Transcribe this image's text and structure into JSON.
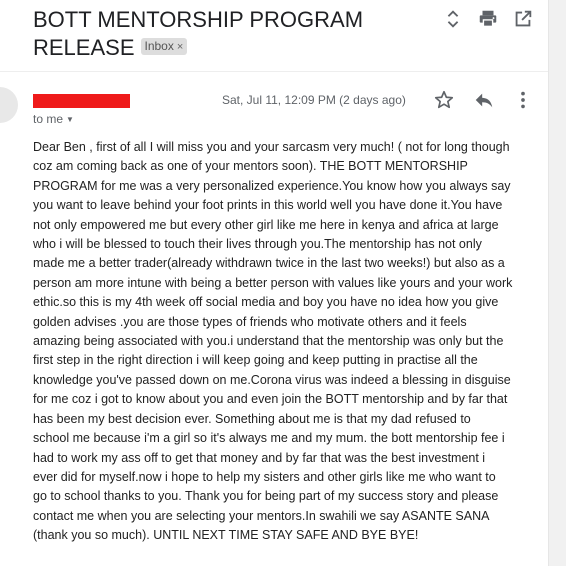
{
  "email": {
    "subject_line1": "BOTT MENTORSHIP PROGRAM",
    "subject_line2": "RELEASE",
    "label_chip": "Inbox",
    "label_remove": "×",
    "date": "Sat, Jul 11, 12:09 PM (2 days ago)",
    "to_text": "to me",
    "to_caret": "▼",
    "body_lines": [
      "Dear Ben , first of all I will miss you and your sarcasm very much! ( not for long though",
      "coz am coming back as one of your mentors soon). THE BOTT MENTORSHIP",
      "PROGRAM for me was a very personalized experience.You know how you always say",
      "you want to leave behind your foot prints in this world well you have done it.You have",
      "not only empowered me but every other girl like me here in kenya  and africa at large",
      "who i will be  blessed to touch their lives through you.The mentorship has not only",
      "made me a better trader(already withdrawn twice in the last two weeks!) but also as a",
      "person am more intune with being a better person with values like yours and your work",
      "ethic.so this is my 4th week off social media and boy you have no idea how you give",
      "golden advises .you are those types of friends who motivate others and it feels",
      "amazing being associated with you.i understand that the mentorship was only but the",
      "first step in the right direction i will keep going and keep putting in practise all the",
      "knowledge you've passed down on me.Corona virus was indeed a blessing in disguise",
      "for me coz i got to know about you and even join the BOTT mentorship and by far that",
      "has been my best decision ever. Something about me is that my dad refused to",
      "school me because i'm a girl so it's always me and my mum. the bott mentorship fee i",
      "had to work my ass off to get that money and by far that was the best investment i",
      "ever did for myself.now i hope to help my sisters and  other girls like me who want to",
      "go to school thanks to you. Thank you for being part of my success story and please",
      "contact me when you are selecting your mentors.In swahili we  say ASANTE SANA",
      "(thank you so much). UNTIL NEXT TIME STAY SAFE AND BYE BYE!"
    ]
  },
  "icons": {
    "expand": "unfold-icon",
    "print": "print-icon",
    "open_new": "open-in-new-window-icon",
    "star": "star-icon",
    "reply": "reply-icon",
    "more": "more-vert-icon"
  },
  "colors": {
    "redaction": "#ef1a1a",
    "icon": "#5f6368",
    "chip_bg": "#dddddd"
  }
}
